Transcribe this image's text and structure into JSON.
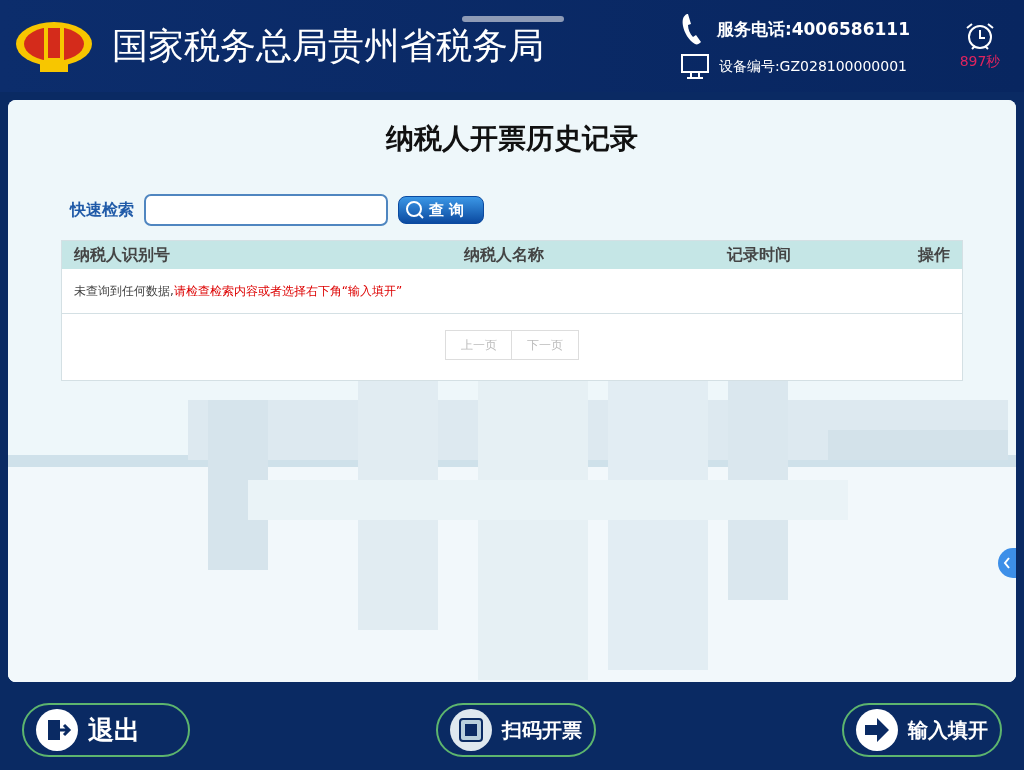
{
  "header": {
    "title": "国家税务总局贵州省税务局",
    "phone": "服务电话:4006586111",
    "device": "设备编号:GZ028100000001",
    "countdown": "897秒"
  },
  "page": {
    "title": "纳税人开票历史记录"
  },
  "search": {
    "label": "快速检索",
    "button": "查 询"
  },
  "table": {
    "columns": [
      "纳税人识别号",
      "纳税人名称",
      "记录时间",
      "操作"
    ],
    "message": {
      "text": "未查询到任何数据,",
      "hint": "请检查检索内容或者选择右下角“输入填开”"
    },
    "pager": [
      {
        "label": "上一页",
        "disabled": true
      },
      {
        "label": "下一页",
        "disabled": true
      }
    ]
  },
  "footer": [
    {
      "kind": "exit",
      "label": "退出"
    },
    {
      "kind": "scan",
      "label": "扫码开票"
    },
    {
      "kind": "input",
      "label": "输入填开"
    }
  ]
}
